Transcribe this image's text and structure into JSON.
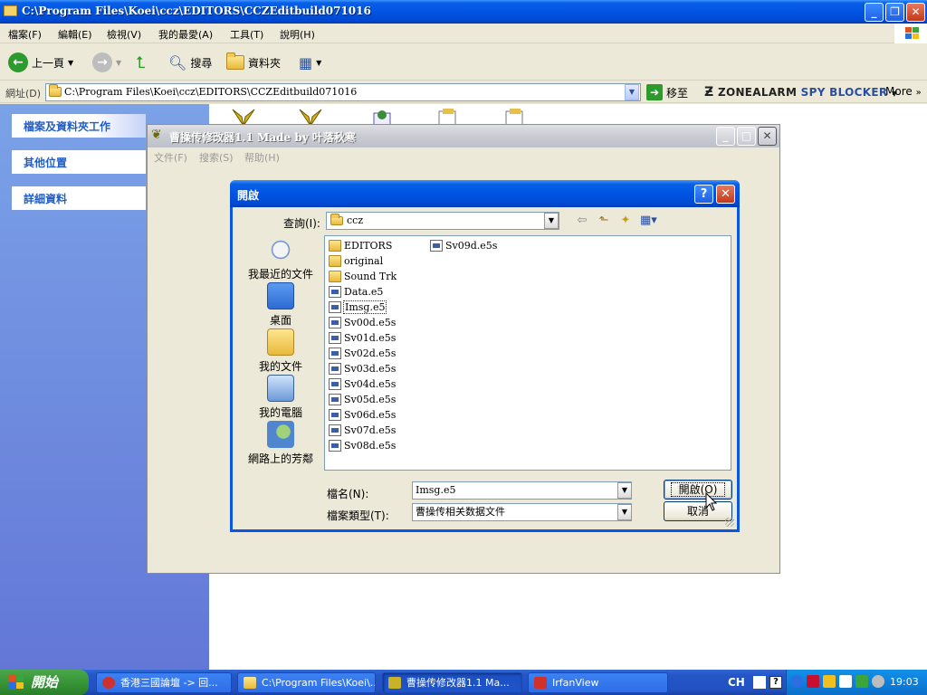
{
  "explorer": {
    "title": "C:\\Program Files\\Koei\\ccz\\EDITORS\\CCZEditbuild071016",
    "menu": [
      "檔案(F)",
      "編輯(E)",
      "檢視(V)",
      "我的最愛(A)",
      "工具(T)",
      "說明(H)"
    ],
    "toolbar": {
      "back": "上一頁",
      "search": "搜尋",
      "folders": "資料夾"
    },
    "address_label": "網址(D)",
    "address_value": "C:\\Program Files\\Koei\\ccz\\EDITORS\\CCZEditbuild071016",
    "go_label": "移至",
    "zonealarm_label": "ZONEALARM",
    "zonealarm_suffix": "SPY BLOCKER",
    "more_label": "More",
    "taskpane": [
      "檔案及資料夾工作",
      "其他位置",
      "詳細資料"
    ]
  },
  "app": {
    "title": "曹操传修改器1.1 Made by 叶落秋寒",
    "menu": [
      "文件(F)",
      "搜索(S)",
      "帮助(H)"
    ]
  },
  "dialog": {
    "title": "開啟",
    "look_in_label": "查詢(I):",
    "look_in_value": "ccz",
    "places": [
      "我最近的文件",
      "桌面",
      "我的文件",
      "我的電腦",
      "網路上的芳鄰"
    ],
    "files_col1": [
      {
        "name": "EDITORS",
        "type": "folder"
      },
      {
        "name": "original",
        "type": "folder"
      },
      {
        "name": "Sound Trk",
        "type": "folder"
      },
      {
        "name": "Data.e5",
        "type": "file"
      },
      {
        "name": "Imsg.e5",
        "type": "file",
        "selected": true
      },
      {
        "name": "Sv00d.e5s",
        "type": "file"
      },
      {
        "name": "Sv01d.e5s",
        "type": "file"
      },
      {
        "name": "Sv02d.e5s",
        "type": "file"
      },
      {
        "name": "Sv03d.e5s",
        "type": "file"
      },
      {
        "name": "Sv04d.e5s",
        "type": "file"
      },
      {
        "name": "Sv05d.e5s",
        "type": "file"
      },
      {
        "name": "Sv06d.e5s",
        "type": "file"
      },
      {
        "name": "Sv07d.e5s",
        "type": "file"
      },
      {
        "name": "Sv08d.e5s",
        "type": "file"
      }
    ],
    "files_col2": [
      {
        "name": "Sv09d.e5s",
        "type": "file"
      }
    ],
    "filename_label": "檔名(N):",
    "filename_value": "Imsg.e5",
    "filetype_label": "檔案類型(T):",
    "filetype_value": "曹操传相关数据文件",
    "open_button": "開啟(O)",
    "cancel_button": "取消"
  },
  "taskbar": {
    "start_label": "開始",
    "tasks": [
      "香港三國論壇 -> 回...",
      "C:\\Program Files\\Koei\\...",
      "曹操传修改器1.1 Ma...",
      "IrfanView"
    ],
    "lang": "CH",
    "clock": "19:03"
  }
}
